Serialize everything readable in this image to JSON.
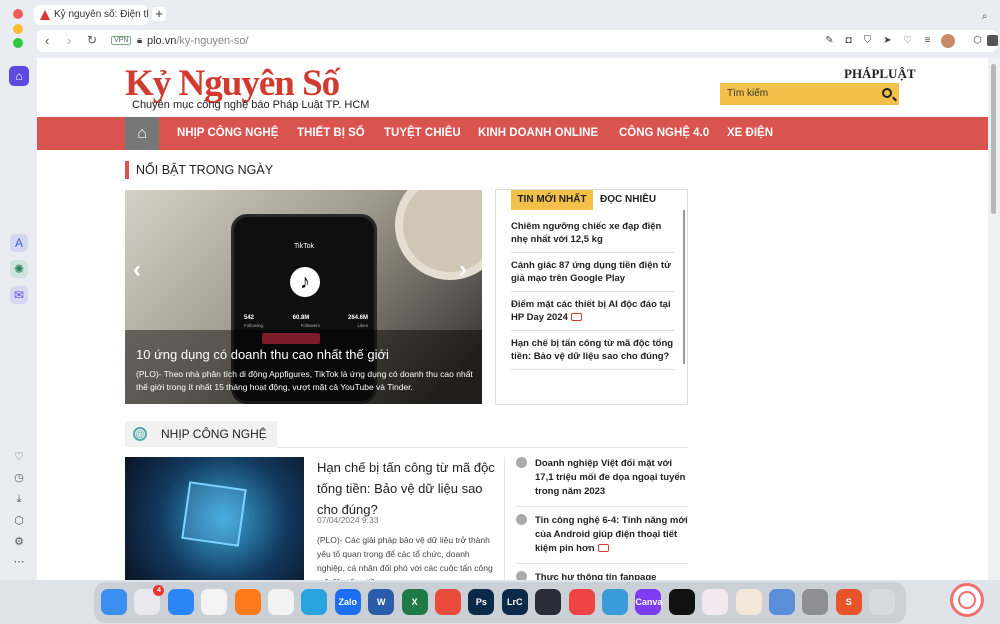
{
  "browser": {
    "tab_title": "Kỷ nguyên số: Điện thoại",
    "new_tab_label": "+",
    "vpn_label": "VPN",
    "url_host": "plo.vn",
    "url_path": "/ky-nguyen-so/"
  },
  "site": {
    "logo": "Kỷ Nguyên Số",
    "slogan": "Chuyên mục công nghệ báo Pháp Luật TP. HCM",
    "brand": "PHÁPLUẬT",
    "search_placeholder": "Tìm kiếm"
  },
  "nav": {
    "items": [
      {
        "label": "NHỊP CÔNG NGHỆ"
      },
      {
        "label": "THIẾT BỊ SỐ"
      },
      {
        "label": "TUYỆT CHIÊU"
      },
      {
        "label": "KINH DOANH ONLINE"
      },
      {
        "label": "CÔNG NGHỆ 4.0"
      },
      {
        "label": "XE ĐIỆN"
      }
    ]
  },
  "highlight": {
    "section_title": "NỔI BẬT TRONG NGÀY",
    "hero_title": "10 ứng dụng có doanh thu cao nhất thế giới",
    "hero_desc": "(PLO)- Theo nhà phân tích di động Appfigures, TikTok là ứng dụng có doanh thu cao nhất thế giới trong ít nhất 15 tháng hoạt động, vượt mặt cả YouTube và Tinder.",
    "phone_app": "TikTok",
    "phone_stats": [
      "542",
      "60.8M",
      "264.6M"
    ],
    "phone_stat_labels": [
      "Following",
      "Followers",
      "Likes"
    ]
  },
  "latest": {
    "tab_latest": "TIN MỚI NHẤT",
    "tab_most_read": "ĐỌC NHIỀU",
    "items": [
      {
        "title": "Chiêm ngưỡng chiếc xe đạp điện nhẹ nhất với 12,5 kg"
      },
      {
        "title": "Cảnh giác 87 ứng dụng tiền điện tử giả mạo trên Google Play"
      },
      {
        "title": "Điểm mặt các thiết bị AI độc đáo tại HP Day 2024"
      },
      {
        "title": "Hạn chế bị tấn công từ mã độc tống tiền: Bảo vệ dữ liệu sao cho đúng?"
      }
    ]
  },
  "tech": {
    "section_title": "NHỊP CÔNG NGHỆ",
    "main_title": "Hạn chế bị tấn công từ mã độc tống tiền: Bảo vệ dữ liệu sao cho đúng?",
    "main_date": "07/04/2024 9:33",
    "main_desc": "(PLO)- Các giải pháp bảo vệ dữ liệu trở thành yếu tố quan trọng để các tổ chức, doanh nghiệp, cá nhân đối phó với các cuộc tấn công mã độc tống tiền ransomware.",
    "side_items": [
      {
        "title": "Doanh nghiệp Việt đối mặt với 17,1 triệu mối đe dọa ngoại tuyến trong năm 2023"
      },
      {
        "title": "Tin công nghệ 6-4: Tính năng mới của Android giúp điện thoại tiết kiệm pin hơn"
      },
      {
        "title": "Thực hư thông tin fanpage"
      }
    ]
  },
  "dock": {
    "apps": [
      {
        "name": "Finder",
        "label": "",
        "color": "#3b8ff0"
      },
      {
        "name": "Launchpad",
        "label": "",
        "color": "#e8e8ee",
        "badge": "4"
      },
      {
        "name": "Safari",
        "label": "",
        "color": "#2a86f6"
      },
      {
        "name": "Chrome",
        "label": "",
        "color": "#f4f4f4"
      },
      {
        "name": "Firefox",
        "label": "",
        "color": "#ff7a1a"
      },
      {
        "name": "Opera",
        "label": "",
        "color": "#f2f2f2"
      },
      {
        "name": "Telegram",
        "label": "",
        "color": "#2aa3e1"
      },
      {
        "name": "Zalo",
        "label": "Zalo",
        "color": "#1d6ff2"
      },
      {
        "name": "Word",
        "label": "W",
        "color": "#2a5caa"
      },
      {
        "name": "Excel",
        "label": "X",
        "color": "#1f7a45"
      },
      {
        "name": "Creative Cloud",
        "label": "",
        "color": "#ea4c3c"
      },
      {
        "name": "Photoshop",
        "label": "Ps",
        "color": "#0b2a4a"
      },
      {
        "name": "Lightroom Classic",
        "label": "LrC",
        "color": "#0b2a4a"
      },
      {
        "name": "Vectornator",
        "label": "",
        "color": "#2b2b3a"
      },
      {
        "name": "Player",
        "label": "",
        "color": "#e44"
      },
      {
        "name": "Preview",
        "label": "",
        "color": "#3a9bd8"
      },
      {
        "name": "Canva",
        "label": "Canva",
        "color": "#7d3cf0"
      },
      {
        "name": "CapCut",
        "label": "",
        "color": "#111"
      },
      {
        "name": "Arc",
        "label": "",
        "color": "#f4e8f0"
      },
      {
        "name": "Cooking",
        "label": "",
        "color": "#f3e7d9"
      },
      {
        "name": "Photos",
        "label": "",
        "color": "#5b8ed8"
      },
      {
        "name": "System Settings",
        "label": "",
        "color": "#8e8e93"
      },
      {
        "name": "Slides",
        "label": "S",
        "color": "#e8542a"
      },
      {
        "name": "Trash",
        "label": "",
        "color": "#d8dadd"
      }
    ]
  }
}
